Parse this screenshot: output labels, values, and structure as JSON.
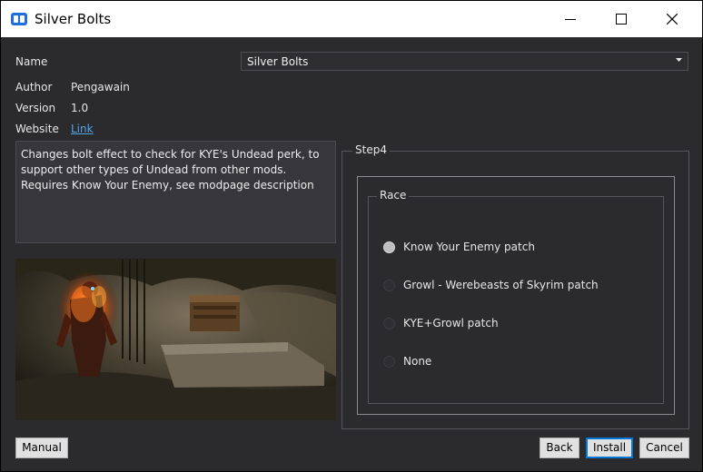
{
  "window": {
    "title": "Silver Bolts",
    "icon": "app-logo-icon",
    "controls": [
      "minimize-icon",
      "maximize-icon",
      "close-icon"
    ]
  },
  "info": {
    "name_label": "Name",
    "name_value": "Silver Bolts",
    "author_label": "Author",
    "author_value": "Pengawain",
    "version_label": "Version",
    "version_value": "1.0",
    "website_label": "Website",
    "website_link": "Link"
  },
  "description": "Changes bolt effect to check for KYE's Undead perk, to support other types of Undead from other mods. Requires Know Your Enemy, see modpage description",
  "step": {
    "title": "Step4",
    "group_title": "Race",
    "options": [
      {
        "label": "Know Your Enemy patch",
        "selected": true
      },
      {
        "label": "Growl - Werebeasts of Skyrim patch",
        "selected": false
      },
      {
        "label": "KYE+Growl patch",
        "selected": false
      },
      {
        "label": "None",
        "selected": false
      }
    ]
  },
  "buttons": {
    "manual": "Manual",
    "back": "Back",
    "install": "Install",
    "cancel": "Cancel"
  },
  "colors": {
    "background": "#2b2b2e",
    "link": "#4ea6ea",
    "accent": "#0078d7"
  }
}
